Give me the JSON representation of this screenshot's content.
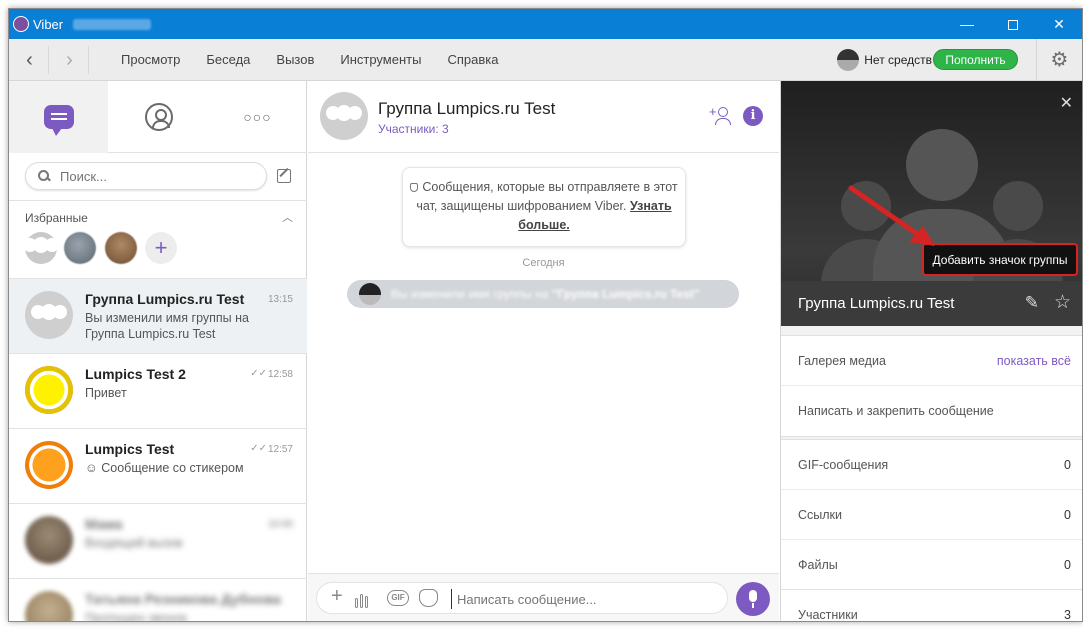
{
  "window": {
    "app_name": "Viber",
    "title_phone_blurred": "+380000000000"
  },
  "menubar": {
    "items": [
      "Просмотр",
      "Беседа",
      "Вызов",
      "Инструменты",
      "Справка"
    ],
    "credit_label": "Нет средств",
    "topup_label": "Пополнить"
  },
  "sidebar": {
    "search_placeholder": "Поиск...",
    "favorites_label": "Избранные",
    "chats": [
      {
        "name": "Группа Lumpics.ru Test",
        "time": "13:15",
        "preview": "Вы изменили имя группы на Группа Lumpics.ru Test"
      },
      {
        "name": "Lumpics Test 2",
        "time": "12:58",
        "ticks": "✓✓",
        "preview": "Привет"
      },
      {
        "name": "Lumpics Test",
        "time": "12:57",
        "ticks": "✓✓",
        "preview": "Сообщение со стикером",
        "preview_icon": "sticker-icon"
      },
      {
        "name": "Мама",
        "time": "10:00",
        "preview": "Входящий вызов"
      },
      {
        "name": "Татьяна Резникова Дубнова",
        "time": "",
        "preview": "Пропущен звонок"
      }
    ]
  },
  "conversation": {
    "title": "Группа Lumpics.ru Test",
    "subtitle": "Участники: 3",
    "notice_text": "Сообщения, которые вы отправляете в этот чат, защищены шифрованием Viber.",
    "notice_link": "Узнать больше.",
    "date_separator": "Сегодня",
    "system_message_prefix": "Вы изменили имя группы на ",
    "system_message_name": "\"Группа Lumpics.ru Test\"",
    "composer_placeholder": "Написать сообщение..."
  },
  "info_panel": {
    "add_icon_label": "Добавить значок группы",
    "group_name": "Группа Lumpics.ru Test",
    "media_gallery_label": "Галерея медиа",
    "media_gallery_link": "показать всё",
    "pin_message_label": "Написать и закрепить сообщение",
    "gif_label": "GIF-сообщения",
    "gif_count": "0",
    "links_label": "Ссылки",
    "links_count": "0",
    "files_label": "Файлы",
    "files_count": "0",
    "members_label": "Участники",
    "members_count": "3"
  },
  "colors": {
    "titlebar": "#0a7fd6",
    "accent": "#7c5ac2",
    "topup": "#2fb44a",
    "annotation": "#d62323"
  }
}
